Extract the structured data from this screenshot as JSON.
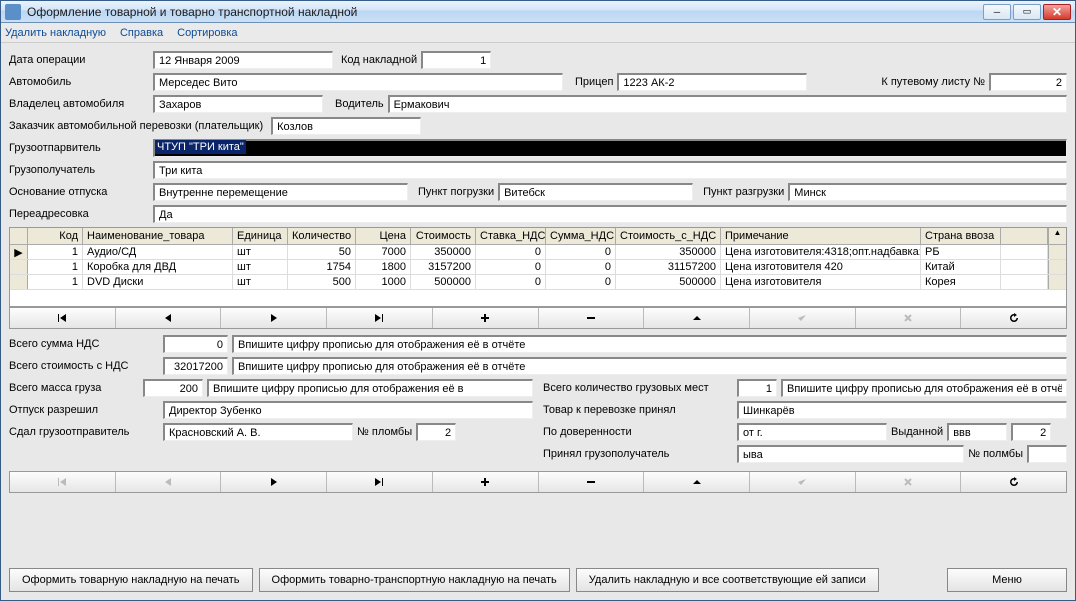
{
  "window": {
    "title": "Оформление товарной и товарно транспортной накладной"
  },
  "menu": {
    "delete": "Удалить накладную",
    "help": "Справка",
    "sort": "Сортировка"
  },
  "labels": {
    "date": "Дата операции",
    "code": "Код накладной",
    "car": "Автомобиль",
    "trailer": "Прицеп",
    "waybill": "К путевому листу №",
    "owner": "Владелец автомобиля",
    "driver": "Водитель",
    "customer": "Заказчик автомобильной перевозки (плательщик)",
    "sender": "Грузоотпарвитель",
    "receiver": "Грузополучатель",
    "basis": "Основание отпуска",
    "loadpoint": "Пункт погрузки",
    "unloadpoint": "Пункт разгрузки",
    "readdress": "Переадресовка",
    "ndsTotal": "Всего сумма НДС",
    "costTotal": "Всего стоимость с НДС",
    "massTotal": "Всего масса груза",
    "allowed": "Отпуск разрешил",
    "senderGave": "Сдал грузоотправитель",
    "sealNo": "№ пломбы",
    "placesTotal": "Всего количество грузовых мест",
    "accepted": "Товар к перевозке принял",
    "byProxy": "По доверенности",
    "issued": "Выданной",
    "received": "Принял грузополучатель",
    "sealNo2": "№ полмбы",
    "longHint": "Впишите цифру прописью для отображения её в отчёте",
    "longHintShort": "Впишите цифру прописью для отображения её в"
  },
  "values": {
    "date": "12 Января 2009",
    "code": "1",
    "car": "Мерседес Вито",
    "trailer": "1223 АК-2",
    "waybill": "2",
    "owner": "Захаров",
    "driver": "Ермакович",
    "customer": "Козлов",
    "sender": "ЧТУП \"ТРИ кита\"",
    "receiver": "Три кита",
    "basis": "Внутренне перемещение",
    "loadpoint": "Витебск",
    "unloadpoint": "Минск",
    "readdress": "Да",
    "ndsTotal": "0",
    "costTotal": "32017200",
    "massTotal": "200",
    "allowed": "Директор Зубенко",
    "senderGave": "Красновский А. В.",
    "sealNo": "2",
    "placesTotal": "1",
    "accepted": "Шинкарёв",
    "proxyFrom": "от г.",
    "issued": "ввв",
    "issuedNo": "2",
    "received": "ыва"
  },
  "grid": {
    "headers": {
      "code": "Код",
      "name": "Наименование_товара",
      "unit": "Единица",
      "qty": "Количество",
      "price": "Цена",
      "cost": "Стоимость",
      "ndsRate": "Ставка_НДС",
      "ndsSum": "Сумма_НДС",
      "costNds": "Стоимость_с_НДС",
      "note": "Примечание",
      "country": "Страна ввоза"
    },
    "rows": [
      {
        "code": "1",
        "name": "Аудио/СД",
        "unit": "шт",
        "qty": "50",
        "price": "7000",
        "cost": "350000",
        "ndsRate": "0",
        "ndsSum": "0",
        "costNds": "350000",
        "note": "Цена изготовителя:4318;опт.надбавка:",
        "country": "РБ"
      },
      {
        "code": "1",
        "name": "Коробка для ДВД",
        "unit": "шт",
        "qty": "1754",
        "price": "1800",
        "cost": "3157200",
        "ndsRate": "0",
        "ndsSum": "0",
        "costNds": "31157200",
        "note": "Цена изготовителя 420",
        "country": "Китай"
      },
      {
        "code": "1",
        "name": "DVD Диски",
        "unit": "шт",
        "qty": "500",
        "price": "1000",
        "cost": "500000",
        "ndsRate": "0",
        "ndsSum": "0",
        "costNds": "500000",
        "note": "Цена изготовителя",
        "country": "Корея"
      }
    ]
  },
  "actions": {
    "printGoods": "Оформить товарную накладную на печать",
    "printTransport": "Оформить товарно-транспортную накладную на печать",
    "deleteAll": "Удалить накладную и все соответствующие ей записи",
    "menu": "Меню"
  }
}
